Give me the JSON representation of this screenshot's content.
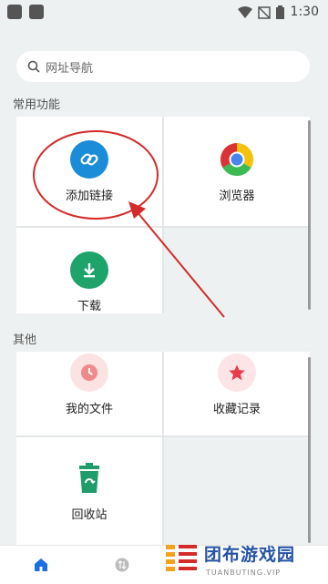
{
  "status_bar": {
    "time": "1:30"
  },
  "search": {
    "placeholder": "网址导航"
  },
  "sections": {
    "common": {
      "title": "常用功能"
    },
    "other": {
      "title": "其他"
    }
  },
  "common_items": [
    {
      "label": "添加链接"
    },
    {
      "label": "浏览器"
    },
    {
      "label": "下载"
    }
  ],
  "other_items": [
    {
      "label": "我的文件"
    },
    {
      "label": "收藏记录"
    },
    {
      "label": "回收站"
    }
  ],
  "colors": {
    "add_link": "#1b8dd8",
    "download": "#1ea36b",
    "files": "#f08a8a",
    "favorites": "#e83c4c",
    "recycle": "#1e9d6a",
    "annotation": "#d42a2a"
  },
  "watermark": {
    "text": "团布游戏园",
    "sub": "TUANBUTING.VIP"
  }
}
